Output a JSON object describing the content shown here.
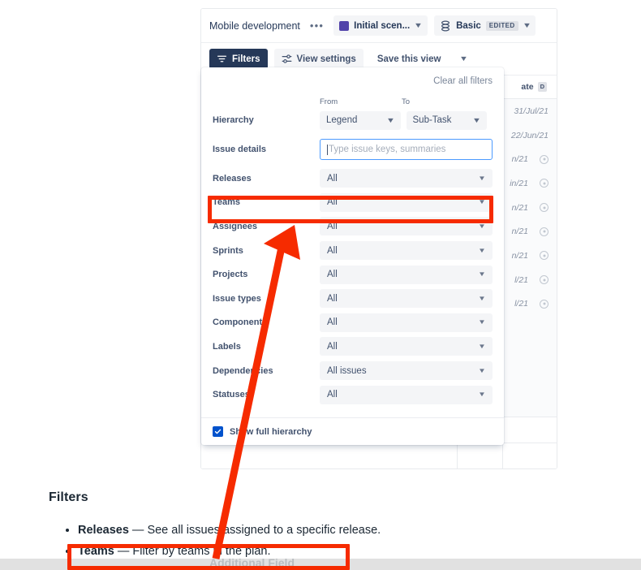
{
  "topbar": {
    "plan_title": "Mobile development",
    "more_label": "•••",
    "scenario_label": "Initial scen...",
    "scenario_color": "#5243aa",
    "view_label": "Basic",
    "edited_badge": "EDITED"
  },
  "toolbar": {
    "filters_label": "Filters",
    "view_settings_label": "View settings",
    "save_view_label": "Save this view"
  },
  "filters_panel": {
    "clear_all_label": "Clear all filters",
    "hierarchy": {
      "label": "Hierarchy",
      "from_header": "From",
      "to_header": "To",
      "from_value": "Legend",
      "to_value": "Sub-Task"
    },
    "issue_details": {
      "label": "Issue details",
      "value": "",
      "placeholder": "Type issue keys, summaries"
    },
    "rows": [
      {
        "label": "Releases",
        "value": "All"
      },
      {
        "label": "Teams",
        "value": "All"
      },
      {
        "label": "Assignees",
        "value": "All"
      },
      {
        "label": "Sprints",
        "value": "All"
      },
      {
        "label": "Projects",
        "value": "All"
      },
      {
        "label": "Issue types",
        "value": "All"
      },
      {
        "label": "Components",
        "value": "All"
      },
      {
        "label": "Labels",
        "value": "All"
      },
      {
        "label": "Dependencies",
        "value": "All issues"
      },
      {
        "label": "Statuses",
        "value": "All"
      }
    ],
    "show_full_hierarchy_label": "Show full hierarchy",
    "show_full_hierarchy_checked": true
  },
  "grid": {
    "date_header": "ate",
    "date_header_badge": "D",
    "rows": [
      {
        "date": "31/Jul/21",
        "has_remove": false
      },
      {
        "date": "22/Jun/21",
        "has_remove": false
      },
      {
        "date": "n/21",
        "has_remove": true
      },
      {
        "date": "in/21",
        "has_remove": true
      },
      {
        "date": "n/21",
        "has_remove": true
      },
      {
        "date": "n/21",
        "has_remove": true
      },
      {
        "date": "n/21",
        "has_remove": true
      },
      {
        "date": "l/21",
        "has_remove": true
      },
      {
        "date": "l/21",
        "has_remove": true
      }
    ]
  },
  "caption": {
    "heading": "Filters",
    "bullets": [
      {
        "term": "Releases",
        "dash": " — ",
        "text": "See all issues assigned to a specific release."
      },
      {
        "term": "Teams",
        "dash": " — ",
        "text": "Filter by teams in the plan."
      }
    ],
    "clipped_text": "Additional Field"
  },
  "annotations": {
    "highlight_color": "#f62b00",
    "arrow_from": "Teams bullet in caption",
    "arrow_to": "Teams filter row"
  }
}
